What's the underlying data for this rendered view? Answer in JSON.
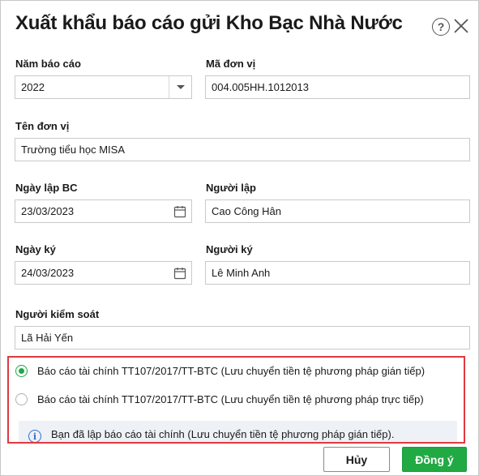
{
  "dialog": {
    "title": "Xuất khẩu báo cáo gửi Kho Bạc Nhà Nước",
    "help_symbol": "?"
  },
  "form": {
    "year": {
      "label": "Năm báo cáo",
      "value": "2022"
    },
    "unit_code": {
      "label": "Mã đơn vị",
      "value": "004.005HH.1012013"
    },
    "unit_name": {
      "label": "Tên đơn vị",
      "value": "Trường tiểu học MISA"
    },
    "report_date": {
      "label": "Ngày lập BC",
      "value": "23/03/2023"
    },
    "preparer": {
      "label": "Người lập",
      "value": "Cao Công Hân"
    },
    "sign_date": {
      "label": "Ngày ký",
      "value": "24/03/2023"
    },
    "signer": {
      "label": "Người ký",
      "value": "Lê Minh Anh"
    },
    "controller": {
      "label": "Người kiểm soát",
      "value": "Lã Hải Yến"
    }
  },
  "report_options": [
    {
      "label": "Báo cáo tài chính TT107/2017/TT-BTC (Lưu chuyển tiền tệ phương pháp gián tiếp)",
      "selected": true
    },
    {
      "label": "Báo cáo tài chính TT107/2017/TT-BTC (Lưu chuyển tiền tệ phương pháp trực tiếp)",
      "selected": false
    }
  ],
  "info": {
    "icon_symbol": "i",
    "text": "Bạn đã lập báo cáo tài chính (Lưu chuyển tiền tệ phương pháp gián tiếp)."
  },
  "buttons": {
    "cancel": "Hủy",
    "ok": "Đồng ý"
  },
  "colors": {
    "accent_green": "#21a944",
    "highlight_border": "#e0393e",
    "info_blue": "#2f6fd1",
    "info_background": "#eef1f6"
  },
  "icons": {
    "help": "help-circle-icon",
    "close": "close-icon",
    "dropdown": "chevron-down-icon",
    "calendar": "calendar-icon",
    "info": "info-icon"
  }
}
